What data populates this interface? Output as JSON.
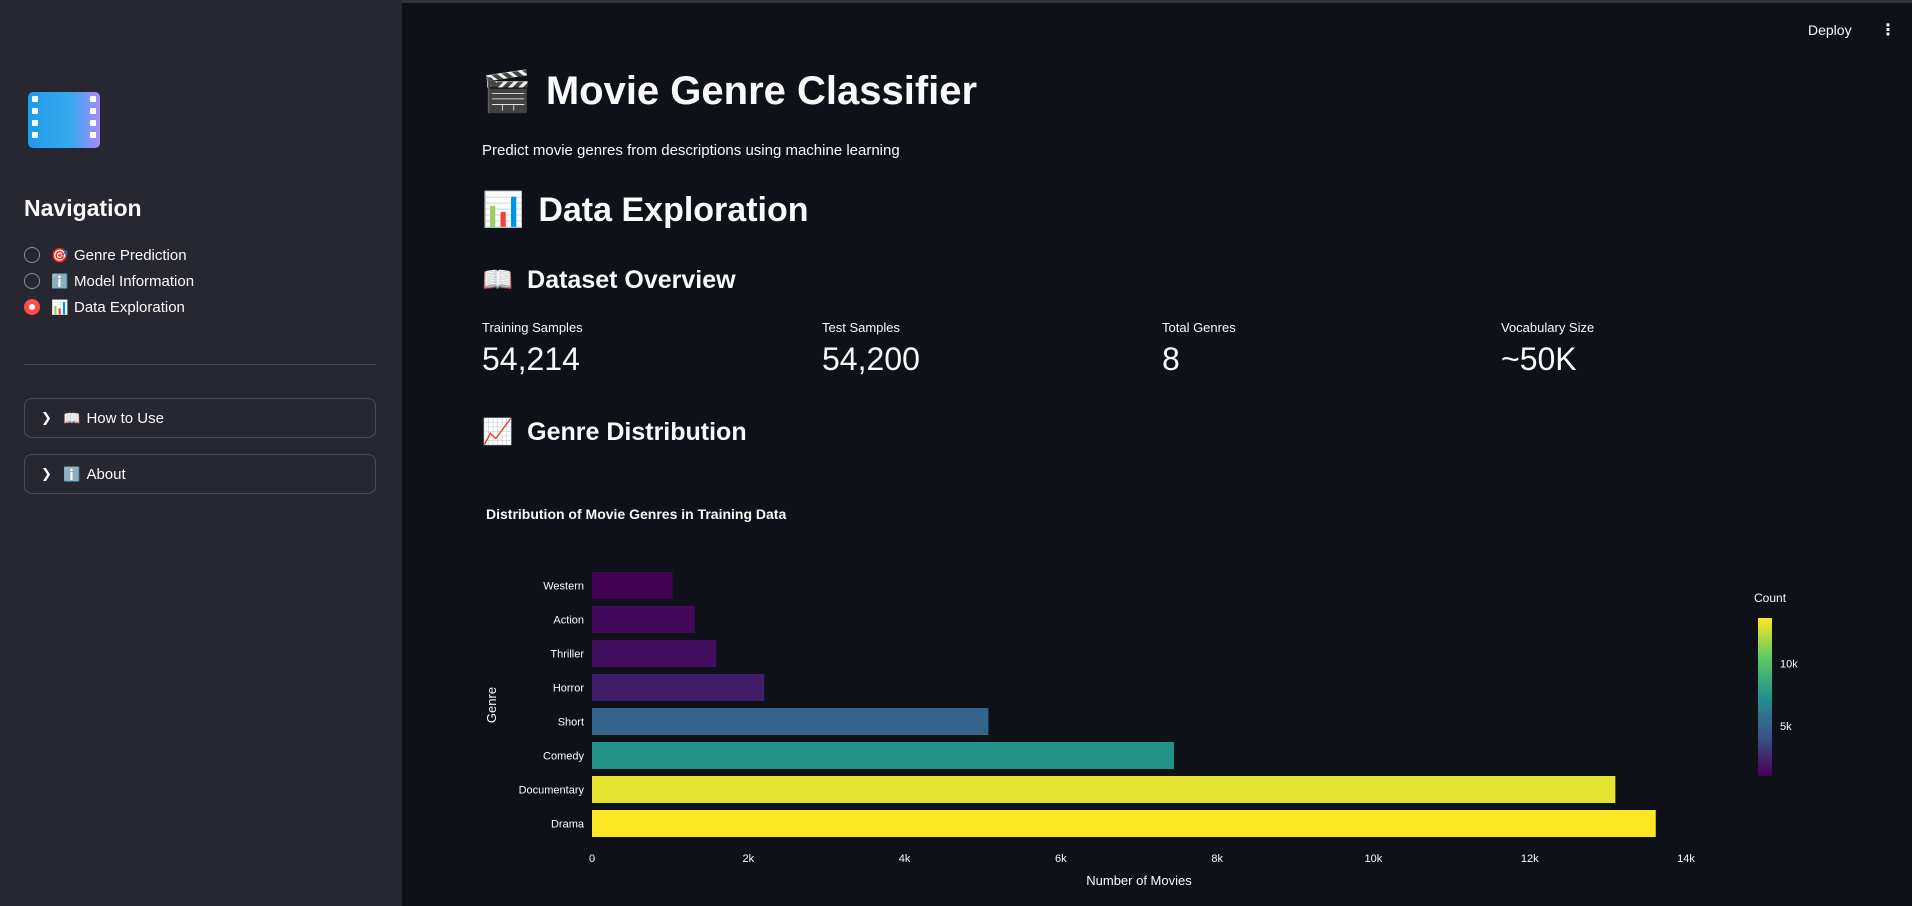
{
  "app": {
    "deploy_label": "Deploy",
    "menu_icon": "kebab-menu-icon"
  },
  "sidebar": {
    "logo_icon": "film-strip-icon",
    "nav_title": "Navigation",
    "nav_items": [
      {
        "emoji": "🎯",
        "label": "Genre Prediction",
        "selected": false
      },
      {
        "emoji": "ℹ️",
        "label": "Model Information",
        "selected": false
      },
      {
        "emoji": "📊",
        "label": "Data Exploration",
        "selected": true
      }
    ],
    "expanders": [
      {
        "emoji": "📖",
        "label": "How to Use"
      },
      {
        "emoji": "ℹ️",
        "label": "About"
      }
    ]
  },
  "main": {
    "title_emoji": "🎬",
    "title": "Movie Genre Classifier",
    "subtitle": "Predict movie genres from descriptions using machine learning",
    "section_emoji": "📊",
    "section_title": "Data Exploration",
    "overview_emoji": "📖",
    "overview_title": "Dataset Overview",
    "metrics": [
      {
        "label": "Training Samples",
        "value": "54,214"
      },
      {
        "label": "Test Samples",
        "value": "54,200"
      },
      {
        "label": "Total Genres",
        "value": "8"
      },
      {
        "label": "Vocabulary Size",
        "value": "~50K"
      }
    ],
    "dist_emoji": "📈",
    "dist_title": "Genre Distribution"
  },
  "chart_data": {
    "type": "bar",
    "orientation": "horizontal",
    "title": "Distribution of Movie Genres in Training Data",
    "xlabel": "Number of Movies",
    "ylabel": "Genre",
    "categories": [
      "Western",
      "Action",
      "Thriller",
      "Horror",
      "Short",
      "Comedy",
      "Documentary",
      "Drama"
    ],
    "values": [
      1032,
      1315,
      1591,
      2204,
      5073,
      7447,
      13096,
      13613
    ],
    "xlim": [
      0,
      14000
    ],
    "xticks": [
      0,
      2000,
      4000,
      6000,
      8000,
      10000,
      12000,
      14000
    ],
    "xtick_labels": [
      "0",
      "2k",
      "4k",
      "6k",
      "8k",
      "10k",
      "12k",
      "14k"
    ],
    "grid": false,
    "colorscale": "viridis",
    "colorbar": {
      "title": "Count",
      "ticks": [
        5000,
        10000
      ],
      "tick_labels": [
        "5k",
        "10k"
      ]
    }
  }
}
